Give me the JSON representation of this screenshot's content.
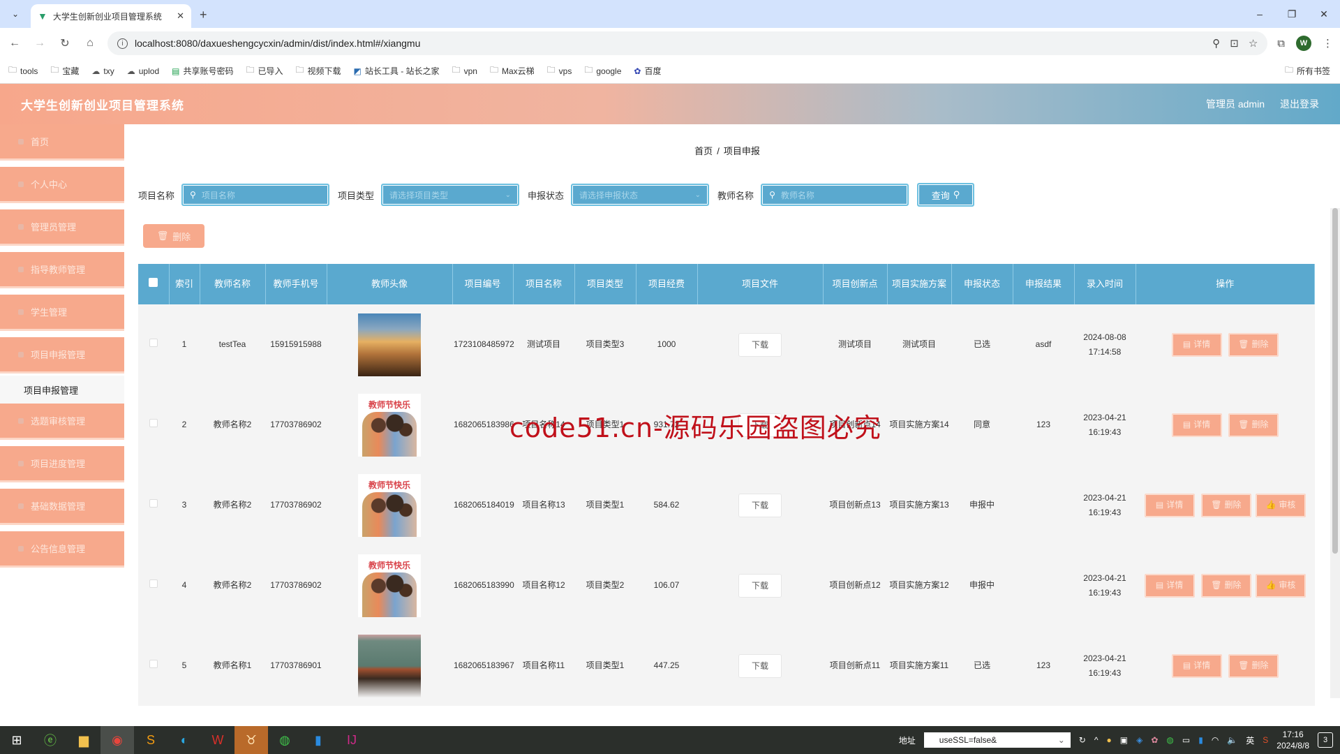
{
  "browser": {
    "tab_title": "大学生创新创业项目管理系统",
    "url": "localhost:8080/daxueshengcycxin/admin/dist/index.html#/xiangmu",
    "profile_initial": "W",
    "bookmarks": [
      "tools",
      "宝藏",
      "txy",
      "uplod",
      "共享账号密码",
      "已导入",
      "视频下载",
      "站长工具 - 站长之家",
      "vpn",
      "Max云梯",
      "vps",
      "google",
      "百度"
    ],
    "all_bookmarks": "所有书签"
  },
  "app": {
    "title": "大学生创新创业项目管理系统",
    "user_label": "管理员 admin",
    "logout": "退出登录"
  },
  "sidebar": {
    "items": [
      {
        "label": "首页"
      },
      {
        "label": "个人中心"
      },
      {
        "label": "管理员管理"
      },
      {
        "label": "指导教师管理"
      },
      {
        "label": "学生管理"
      },
      {
        "label": "项目申报管理"
      },
      {
        "label": "选题审核管理"
      },
      {
        "label": "项目进度管理"
      },
      {
        "label": "基础数据管理"
      },
      {
        "label": "公告信息管理"
      }
    ],
    "submenu_active": "项目申报管理"
  },
  "breadcrumb": {
    "home": "首页",
    "sep": "/",
    "current": "项目申报"
  },
  "search": {
    "name_label": "项目名称",
    "name_placeholder": "项目名称",
    "type_label": "项目类型",
    "type_placeholder": "请选择项目类型",
    "status_label": "申报状态",
    "status_placeholder": "请选择申报状态",
    "teacher_label": "教师名称",
    "teacher_placeholder": "教师名称",
    "query_button": "查询"
  },
  "bulk_delete": "删除",
  "table": {
    "headers": [
      "索引",
      "教师名称",
      "教师手机号",
      "教师头像",
      "项目编号",
      "项目名称",
      "项目类型",
      "项目经费",
      "项目文件",
      "项目创新点",
      "项目实施方案",
      "申报状态",
      "申报结果",
      "录入时间",
      "操作"
    ],
    "download_label": "下载",
    "action_labels": {
      "detail": "详情",
      "delete": "删除",
      "audit": "审核"
    },
    "rows": [
      {
        "index": "1",
        "teacher": "testTea",
        "phone": "15915915988",
        "avatar": "mountain",
        "code": "1723108485972",
        "name": "测试项目",
        "type": "项目类型3",
        "fund": "1000",
        "innovation": "测试项目",
        "plan": "测试项目",
        "status": "已选",
        "result": "asdf",
        "time": "2024-08-08 17:14:58",
        "can_audit": false
      },
      {
        "index": "2",
        "teacher": "教师名称2",
        "phone": "17703786902",
        "avatar": "teacher",
        "code": "1682065183986",
        "name": "项目名称14",
        "type": "项目类型1",
        "fund": "931.72",
        "innovation": "项目创新点14",
        "plan": "项目实施方案14",
        "status": "同意",
        "result": "123",
        "time": "2023-04-21 16:19:43",
        "can_audit": false
      },
      {
        "index": "3",
        "teacher": "教师名称2",
        "phone": "17703786902",
        "avatar": "teacher",
        "code": "1682065184019",
        "name": "项目名称13",
        "type": "项目类型1",
        "fund": "584.62",
        "innovation": "项目创新点13",
        "plan": "项目实施方案13",
        "status": "申报中",
        "result": "",
        "time": "2023-04-21 16:19:43",
        "can_audit": true
      },
      {
        "index": "4",
        "teacher": "教师名称2",
        "phone": "17703786902",
        "avatar": "teacher",
        "code": "1682065183990",
        "name": "项目名称12",
        "type": "项目类型2",
        "fund": "106.07",
        "innovation": "项目创新点12",
        "plan": "项目实施方案12",
        "status": "申报中",
        "result": "",
        "time": "2023-04-21 16:19:43",
        "can_audit": true
      },
      {
        "index": "5",
        "teacher": "教师名称1",
        "phone": "17703786901",
        "avatar": "classroom",
        "code": "1682065183967",
        "name": "项目名称11",
        "type": "项目类型1",
        "fund": "447.25",
        "innovation": "项目创新点11",
        "plan": "项目实施方案11",
        "status": "已选",
        "result": "123",
        "time": "2023-04-21 16:19:43",
        "can_audit": false
      }
    ]
  },
  "watermark": "code51.cn-源码乐园盗图必究",
  "taskbar": {
    "address_label": "地址",
    "address_value": "useSSL=false&",
    "ime": "英",
    "time": "17:16",
    "date": "2024/8/8",
    "notifications": "3"
  }
}
